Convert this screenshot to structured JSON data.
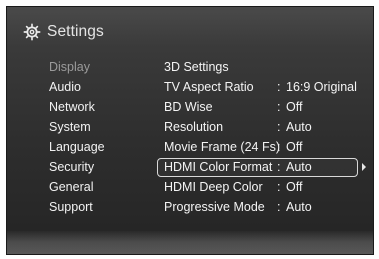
{
  "header": {
    "title": "Settings",
    "icon": "gear-icon"
  },
  "sidebar": {
    "items": [
      {
        "label": "Display",
        "active": true
      },
      {
        "label": "Audio",
        "active": false
      },
      {
        "label": "Network",
        "active": false
      },
      {
        "label": "System",
        "active": false
      },
      {
        "label": "Language",
        "active": false
      },
      {
        "label": "Security",
        "active": false
      },
      {
        "label": "General",
        "active": false
      },
      {
        "label": "Support",
        "active": false
      }
    ]
  },
  "options": [
    {
      "label": "3D Settings",
      "value": ""
    },
    {
      "label": "TV Aspect Ratio",
      "value": "16:9 Original"
    },
    {
      "label": "BD Wise",
      "value": "Off"
    },
    {
      "label": "Resolution",
      "value": "Auto"
    },
    {
      "label": "Movie Frame (24 Fs)",
      "value": "Off"
    },
    {
      "label": "HDMI Color Format",
      "value": "Auto",
      "selected": true
    },
    {
      "label": "HDMI Deep Color",
      "value": "Off"
    },
    {
      "label": "Progressive Mode",
      "value": "Auto"
    }
  ],
  "separator": ":",
  "colors": {
    "text": "#f4f4f4",
    "active_sidebar": "#9a9a9a",
    "highlight_border": "#d9d9d9"
  }
}
